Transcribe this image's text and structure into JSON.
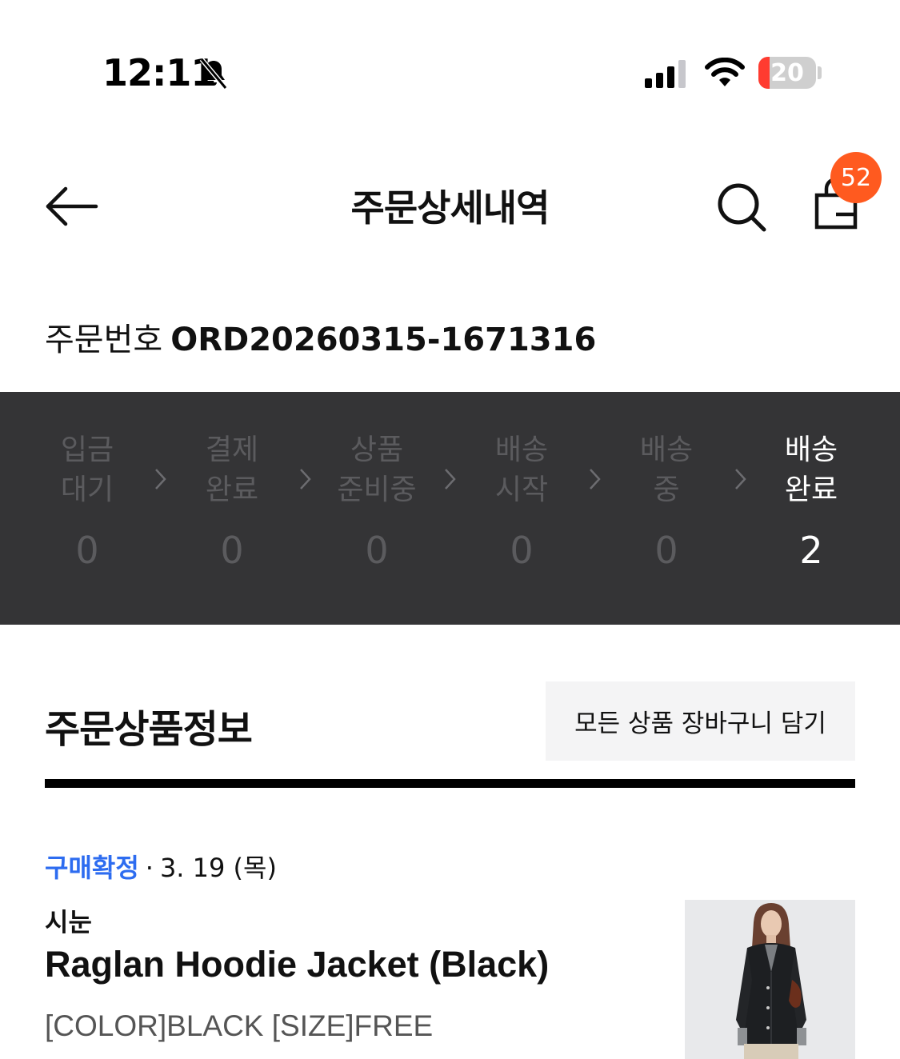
{
  "status_bar": {
    "time": "12:11",
    "battery_level": "20",
    "battery_fraction": 0.2,
    "icons": [
      "bell-slash-icon",
      "cellular-signal-icon",
      "wifi-icon",
      "battery-icon"
    ]
  },
  "header": {
    "title": "주문상세내역",
    "cart_badge_count": "52",
    "icons": [
      "back-arrow-icon",
      "search-icon",
      "shopping-bag-icon"
    ]
  },
  "order": {
    "number_label": "주문번호",
    "number_value": "ORD20260315-1671316"
  },
  "order_status": {
    "steps": [
      {
        "label": "입금\n대기",
        "count": "0",
        "active": false
      },
      {
        "label": "결제\n완료",
        "count": "0",
        "active": false
      },
      {
        "label": "상품\n준비중",
        "count": "0",
        "active": false
      },
      {
        "label": "배송\n시작",
        "count": "0",
        "active": false
      },
      {
        "label": "배송\n중",
        "count": "0",
        "active": false
      },
      {
        "label": "배송\n완료",
        "count": "2",
        "active": true
      }
    ]
  },
  "products_section": {
    "title": "주문상품정보",
    "add_all_to_cart_label": "모든 상품 장바구니 담기"
  },
  "product": {
    "status": "구매확정",
    "separator": "·",
    "date": "3. 19 (목)",
    "brand": "시눈",
    "name": "Raglan Hoodie Jacket (Black)",
    "option": "[COLOR]BLACK [SIZE]FREE"
  },
  "colors": {
    "status_band": "#343436",
    "badge": "#ff5a1f",
    "confirmed_blue": "#2d6cf0",
    "inactive_step": "#5b5b5e",
    "battery_red": "#ff3b30"
  }
}
